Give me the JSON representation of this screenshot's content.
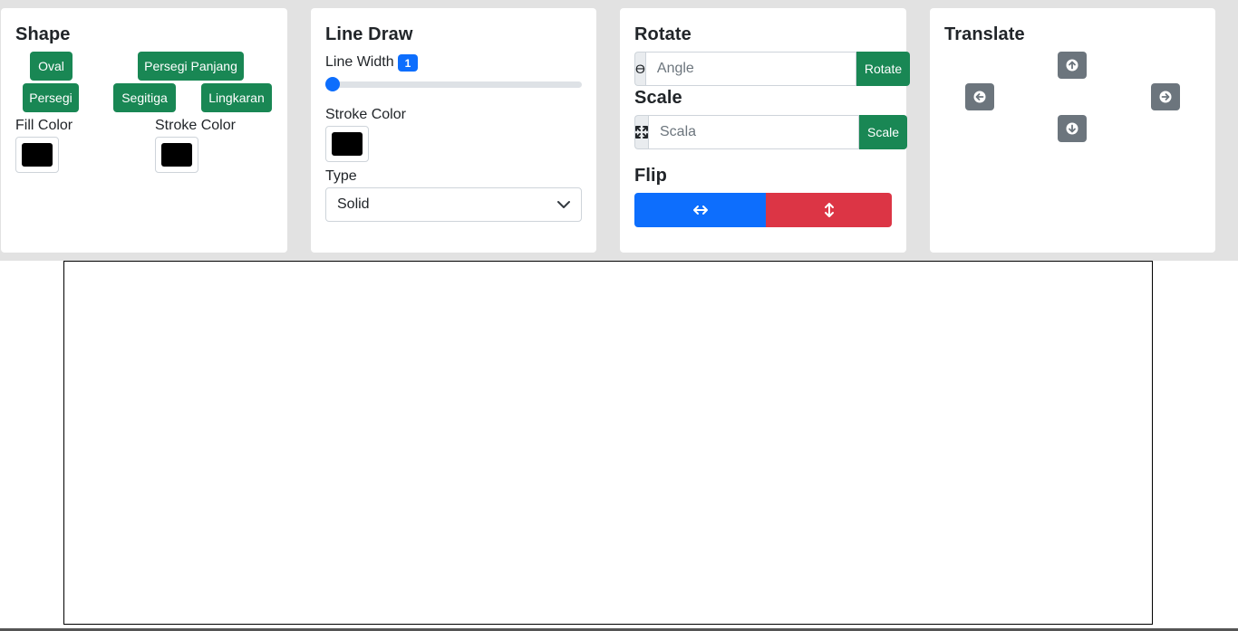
{
  "shape": {
    "title": "Shape",
    "buttons": [
      "Oval",
      "Persegi Panjang",
      "Persegi",
      "Segitiga",
      "Lingkaran"
    ],
    "fill_label": "Fill Color",
    "stroke_label": "Stroke Color",
    "fill_color": "#000000",
    "stroke_color": "#000000"
  },
  "line": {
    "title": "Line Draw",
    "width_label": "Line Width",
    "width_value": "1",
    "stroke_label": "Stroke Color",
    "stroke_color": "#000000",
    "type_label": "Type",
    "type_value": "Solid",
    "slider_fraction": 0
  },
  "rotate": {
    "title": "Rotate",
    "icon": "theta-symbol",
    "icon_glyph": "ϴ",
    "placeholder": "Angle",
    "button": "Rotate"
  },
  "scale": {
    "title": "Scale",
    "icon": "arrows-fullscreen-icon",
    "placeholder": "Scala",
    "button": "Scale"
  },
  "flip": {
    "title": "Flip",
    "horizontal_icon": "arrows-horizontal-icon",
    "vertical_icon": "arrows-vertical-icon",
    "horizontal_color": "#0d6efd",
    "vertical_color": "#dc3545"
  },
  "translate": {
    "title": "Translate",
    "icons": [
      "arrow-up-circle-icon",
      "arrow-left-circle-icon",
      "arrow-right-circle-icon",
      "arrow-down-circle-icon"
    ]
  },
  "colors": {
    "primary": "#0d6efd",
    "success": "#198754",
    "danger": "#dc3545",
    "secondary": "#6c757d"
  }
}
